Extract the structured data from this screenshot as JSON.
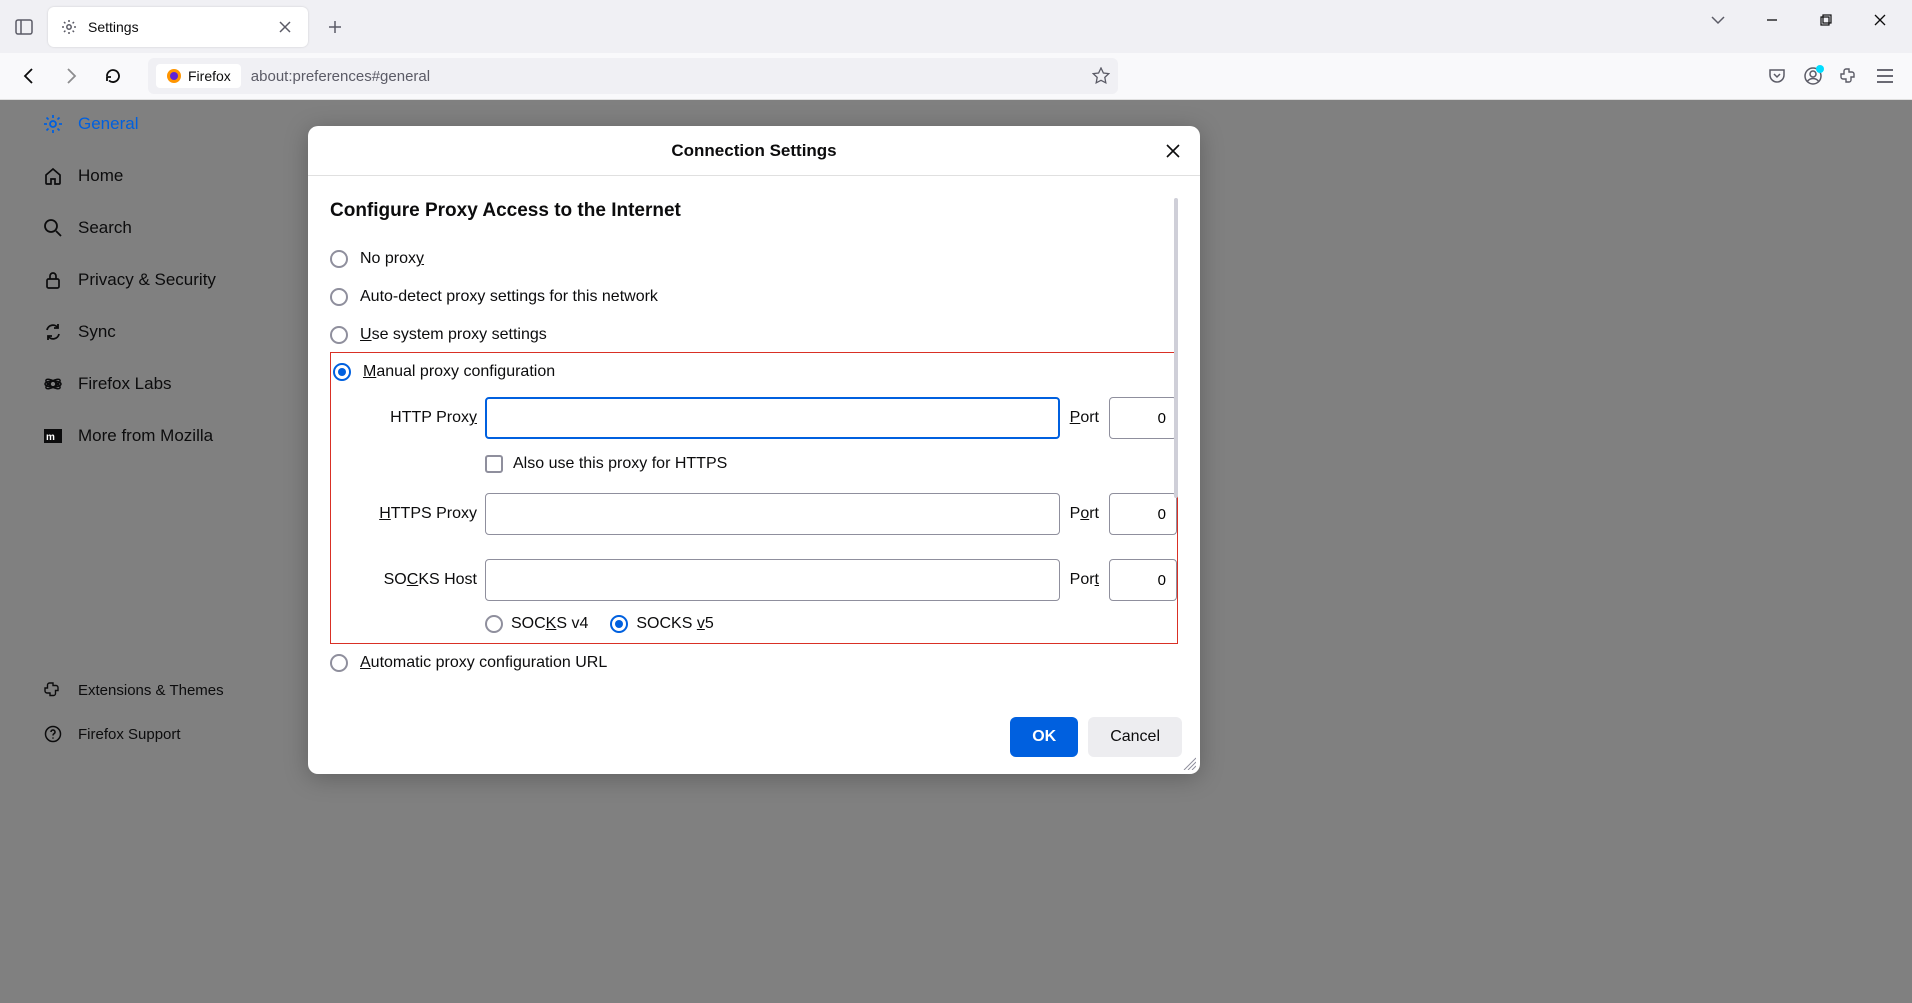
{
  "browser": {
    "tab_title": "Settings",
    "identity_label": "Firefox",
    "url": "about:preferences#general"
  },
  "sidebar": {
    "items": [
      {
        "label": "General"
      },
      {
        "label": "Home"
      },
      {
        "label": "Search"
      },
      {
        "label": "Privacy & Security"
      },
      {
        "label": "Sync"
      },
      {
        "label": "Firefox Labs"
      },
      {
        "label": "More from Mozilla"
      }
    ],
    "footer": [
      {
        "label": "Extensions & Themes"
      },
      {
        "label": "Firefox Support"
      }
    ]
  },
  "modal": {
    "title": "Connection Settings",
    "heading": "Configure Proxy Access to the Internet",
    "options": {
      "no_proxy": "No proxy",
      "auto_detect": "Auto-detect proxy settings for this network",
      "system": "Use system proxy settings",
      "manual": "Manual proxy configuration",
      "auto_url": "Automatic proxy configuration URL"
    },
    "fields": {
      "http_label": "HTTP Proxy",
      "http_value": "",
      "http_port": "0",
      "also_https": "Also use this proxy for HTTPS",
      "https_label": "HTTPS Proxy",
      "https_value": "",
      "https_port": "0",
      "socks_label": "SOCKS Host",
      "socks_value": "",
      "socks_port": "0",
      "socks_v4": "SOCKS v4",
      "socks_v5": "SOCKS v5",
      "port_label": "Port"
    },
    "buttons": {
      "ok": "OK",
      "cancel": "Cancel"
    }
  }
}
